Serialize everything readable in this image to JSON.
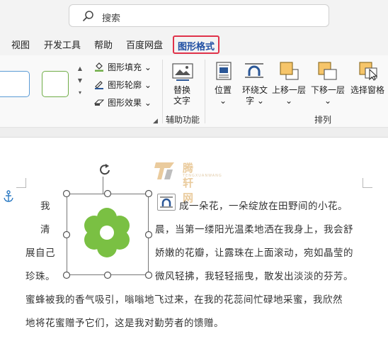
{
  "search": {
    "placeholder": "搜索",
    "icon": "search-icon"
  },
  "tabs": [
    {
      "label": "视图"
    },
    {
      "label": "开发工具"
    },
    {
      "label": "帮助"
    },
    {
      "label": "百度网盘"
    },
    {
      "label": "图形格式",
      "active": true
    }
  ],
  "ribbon": {
    "shape_format": {
      "fill_label": "图形填充",
      "outline_label": "图形轮廓",
      "effects_label": "图形效果"
    },
    "alt_text": {
      "label_line1": "替换",
      "label_line2": "文字",
      "group": "辅助功能"
    },
    "arrange": {
      "position": "位置",
      "wrap_text_line1": "环绕文",
      "wrap_text_line2": "字",
      "bring_forward": "上移一层",
      "send_backward": "下移一层",
      "selection_pane": "选择窗格",
      "group": "排列"
    }
  },
  "colors": {
    "accent_blue": "#2b5797",
    "active_tab_border": "#e0334a",
    "style_box_blue": "#5b9bd5",
    "style_box_green": "#70ad47",
    "flower_green": "#7ac043",
    "layer_orange": "#f6c56a"
  },
  "document": {
    "lines": [
      {
        "left": "我",
        "right": "成一朵花，一朵绽放在田野间的小花。"
      },
      {
        "left": "清",
        "right": "晨，当第一缕阳光温柔地洒在我身上，我会舒"
      },
      {
        "left": "展自己",
        "right": "娇嫩的花瓣，让露珠在上面滚动，宛如晶莹的"
      },
      {
        "left": "珍珠。",
        "right": "微风轻拂，我轻轻摇曳，散发出淡淡的芬芳。"
      }
    ],
    "full_lines": [
      "蜜蜂被我的香气吸引，嗡嗡地飞过来，在我的花蕊间忙碌地采蜜，我欣然",
      "地将花蜜赠予它们，这是我对勤劳者的馈赠。"
    ],
    "watermark": {
      "text": "腾轩网",
      "sub": "TENGXUANWANG"
    }
  }
}
